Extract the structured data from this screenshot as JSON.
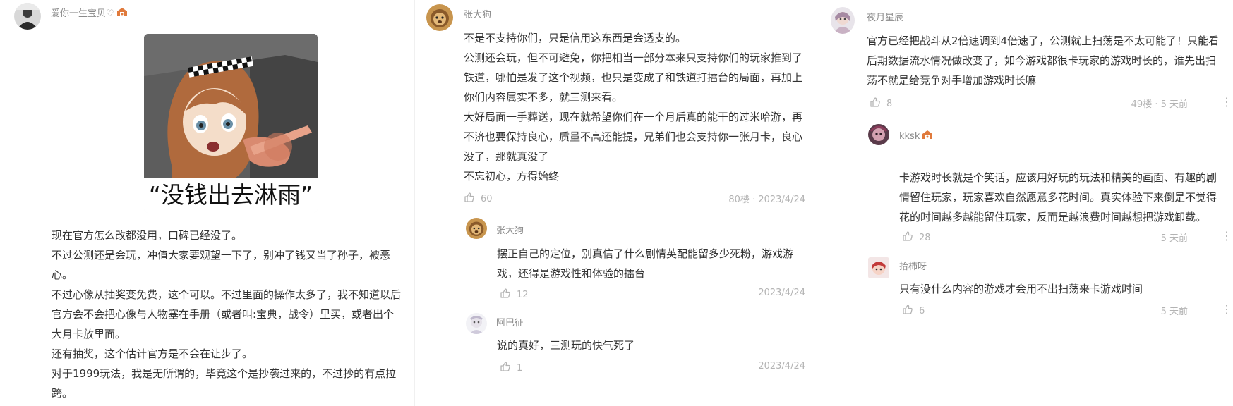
{
  "col1": {
    "user": "爱你一生宝贝♡",
    "meme_caption": "“没钱出去淋雨”",
    "paragraphs": [
      "现在官方怎么改都没用，口碑已经没了。",
      "不过公测还是会玩，冲值大家要观望一下了，别冲了钱又当了孙子，被恶心。",
      "不过心像从抽奖变免费，这个可以。不过里面的操作太多了，我不知道以后官方会不会把心像与人物塞在手册（或者叫:宝典，战令）里买，或者出个大月卡放里面。",
      "还有抽奖，这个估计官方是不会在让步了。",
      "对于1999玩法，我是无所谓的，毕竟这个是抄袭过来的，不过抄的有点拉跨。"
    ]
  },
  "col2": {
    "main": {
      "user": "张大狗",
      "paragraphs": [
        "不是不支持你们，只是信用这东西是会透支的。",
        "公测还会玩，但不可避免，你把相当一部分本来只支持你们的玩家推到了铁道，哪怕是发了这个视频，也只是变成了和铁道打擂台的局面，再加上你们内容属实不多，就三测来看。",
        "大好局面一手葬送，现在就希望你们在一个月后真的能干的过米哈游，再不济也要保持良心，质量不高还能提，兄弟们也会支持你一张月卡，良心没了，那就真没了",
        "不忘初心，方得始终"
      ],
      "likes": "60",
      "meta": "80楼 · 2023/4/24"
    },
    "replies": [
      {
        "user": "张大狗",
        "text": "摆正自己的定位，别真信了什么剧情英配能留多少死粉，游戏游戏，还得是游戏性和体验的擂台",
        "likes": "12",
        "meta": "2023/4/24"
      },
      {
        "user": "阿巴征",
        "text": "说的真好，三测玩的快气死了",
        "likes": "1",
        "meta": "2023/4/24"
      }
    ]
  },
  "col3": {
    "main": {
      "user": "夜月星辰",
      "text": "官方已经把战斗从2倍速调到4倍速了，公测就上扫荡是不太可能了！只能看后期数据流水情况做改变了，如今游戏都很卡玩家的游戏时长的，谁先出扫荡不就是给竞争对手增加游戏时长嘛",
      "likes": "8",
      "meta": "49楼 · 5 天前"
    },
    "replies": [
      {
        "user": "kksk",
        "text": "卡游戏时长就是个笑话，应该用好玩的玩法和精美的画面、有趣的剧情留住玩家，玩家喜欢自然愿意多花时间。真实体验下来倒是不觉得花的时间越多越能留住玩家，反而是越浪费时间越想把游戏卸载。",
        "likes": "28",
        "meta": "5 天前"
      },
      {
        "user": "拾柿呀",
        "text": "只有没什么内容的游戏才会用不出扫荡来卡游戏时间",
        "likes": "6",
        "meta": "5 天前"
      }
    ]
  },
  "icons": {
    "like": "thumbs-up-icon",
    "more": "more-vertical-icon",
    "badge": "level-badge-icon"
  },
  "colors": {
    "text": "#333333",
    "muted": "#8a8a8a",
    "faint": "#b3b3b3"
  }
}
